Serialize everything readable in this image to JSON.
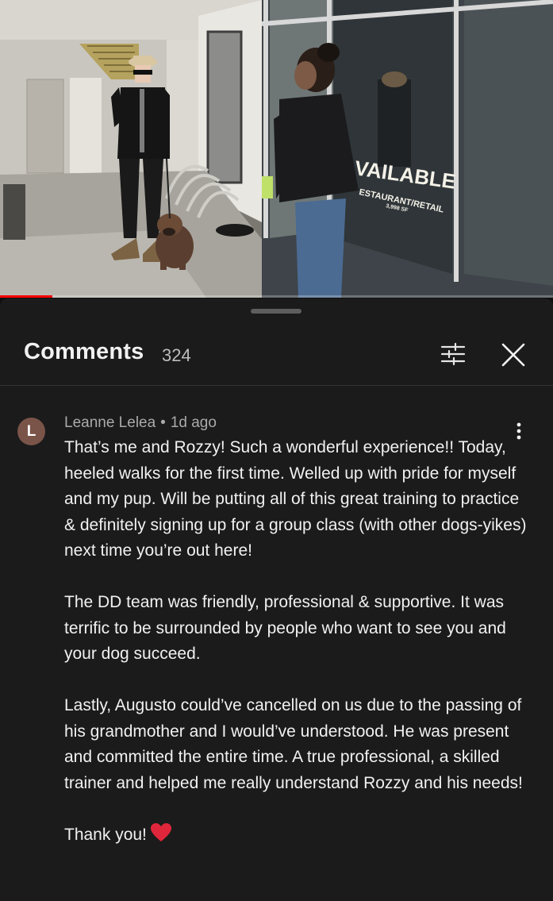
{
  "video": {
    "progress_fraction": 0.095,
    "sign_text": {
      "available": "VAILABLE",
      "restaurant_retail": "ESTAURANT/RETAIL",
      "square_feet": "3,998 SF"
    }
  },
  "comments_panel": {
    "title": "Comments",
    "count": "324",
    "sort_icon": "sort-filter-icon",
    "close_icon": "close-icon"
  },
  "comment": {
    "avatar_letter": "L",
    "avatar_color": "#7a5448",
    "author": "Leanne Lelea",
    "separator": "•",
    "age": "1d ago",
    "paragraphs": [
      "That’s me and Rozzy! Such a wonderful experience!! Today, heeled walks for the first time. Welled up with pride for myself and my pup. Will be putting all of this great training to practice & definitely signing up for a group class (with other dogs-yikes) next time you’re out here!",
      "The DD team was friendly, professional & supportive. It was terrific to be surrounded by people who want to see you and your dog succeed.",
      "Lastly, Augusto could’ve cancelled on us due to the passing of his grandmother and I would’ve understood. He was present and committed the entire time. A true professional, a skilled trainer and helped me really understand Rozzy and his needs!",
      "Thank you!"
    ],
    "heart_icon": "red-heart-icon",
    "more_icon": "more-vert-icon"
  },
  "colors": {
    "background": "#0f0f0f",
    "sheet": "#1b1b1b",
    "progress": "#ff0000",
    "heart": "#e0263a"
  }
}
